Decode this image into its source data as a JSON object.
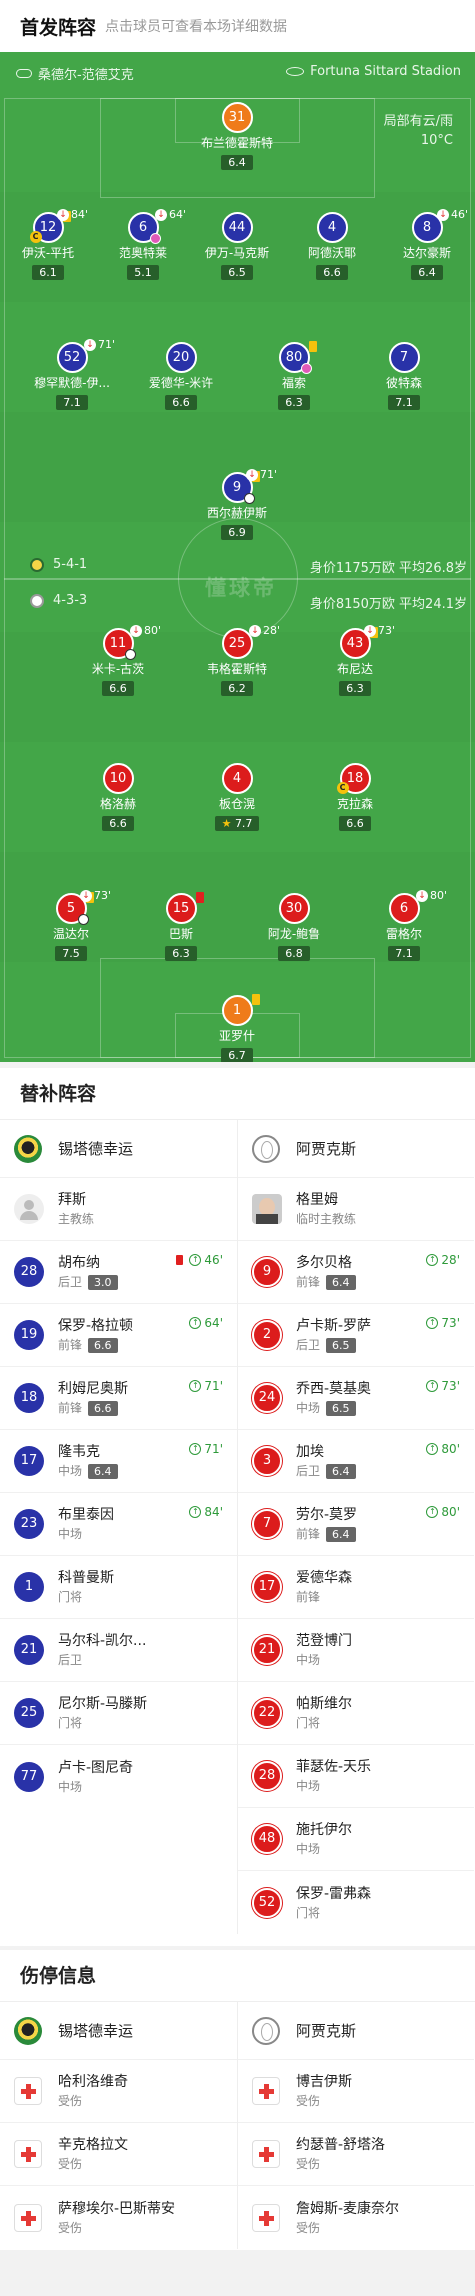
{
  "header": {
    "title": "首发阵容",
    "subtitle": "点击球员可查看本场详细数据"
  },
  "pitch": {
    "home_team": "桑德尔-范德艾克",
    "stadium": "Fortuna Sittard Stadion",
    "weather": "局部有云/雨",
    "temperature": "10°C",
    "watermark": "懂球帝",
    "home_formation": "5-4-1",
    "home_value": "身价1175万欧",
    "home_avg_age": "平均26.8岁",
    "away_formation": "4-3-3",
    "away_value": "身价8150万欧",
    "away_avg_age": "平均24.1岁"
  },
  "home_players": [
    {
      "num": "31",
      "name": "布兰德霍斯特",
      "rating": "6.4"
    },
    {
      "num": "12",
      "name": "伊沃-平托",
      "rating": "6.1",
      "sub": "84'",
      "captain": "C"
    },
    {
      "num": "6",
      "name": "范奥特莱",
      "rating": "5.1",
      "sub": "64'"
    },
    {
      "num": "44",
      "name": "伊万-马克斯",
      "rating": "6.5"
    },
    {
      "num": "4",
      "name": "阿德沃耶",
      "rating": "6.6"
    },
    {
      "num": "8",
      "name": "达尔豪斯",
      "rating": "6.4",
      "sub": "46'"
    },
    {
      "num": "52",
      "name": "穆罕默德-伊...",
      "rating": "7.1",
      "sub": "71'"
    },
    {
      "num": "20",
      "name": "爱德华-米许",
      "rating": "6.6"
    },
    {
      "num": "80",
      "name": "福索",
      "rating": "6.3"
    },
    {
      "num": "7",
      "name": "彼特森",
      "rating": "7.1"
    },
    {
      "num": "9",
      "name": "西尔赫伊斯",
      "rating": "6.9",
      "sub": "71'"
    }
  ],
  "away_players": [
    {
      "num": "11",
      "name": "米卡-古茨",
      "rating": "6.6",
      "sub": "80'"
    },
    {
      "num": "25",
      "name": "韦格霍斯特",
      "rating": "6.2",
      "sub": "28'"
    },
    {
      "num": "43",
      "name": "布尼达",
      "rating": "6.3",
      "sub": "73'"
    },
    {
      "num": "10",
      "name": "格洛赫",
      "rating": "6.6"
    },
    {
      "num": "4",
      "name": "板仓滉",
      "rating": "7.7",
      "star": "★"
    },
    {
      "num": "18",
      "name": "克拉森",
      "rating": "6.6",
      "captain": "C"
    },
    {
      "num": "5",
      "name": "温达尔",
      "rating": "7.5",
      "sub": "73'"
    },
    {
      "num": "15",
      "name": "巴斯",
      "rating": "6.3"
    },
    {
      "num": "30",
      "name": "阿龙-鲍鲁",
      "rating": "6.8"
    },
    {
      "num": "6",
      "name": "雷格尔",
      "rating": "7.1",
      "sub": "80'"
    },
    {
      "num": "1",
      "name": "亚罗什",
      "rating": "6.7"
    }
  ],
  "subs": {
    "title": "替补阵容",
    "home_team": "锡塔德幸运",
    "away_team": "阿贾克斯",
    "home_coach": {
      "name": "拜斯",
      "role": "主教练"
    },
    "away_coach": {
      "name": "格里姆",
      "role": "临时主教练"
    },
    "home": [
      {
        "num": "28",
        "name": "胡布纳",
        "pos": "后卫",
        "rating": "3.0",
        "minute": "46'"
      },
      {
        "num": "19",
        "name": "保罗-格拉顿",
        "pos": "前锋",
        "rating": "6.6",
        "minute": "64'"
      },
      {
        "num": "18",
        "name": "利姆尼奥斯",
        "pos": "前锋",
        "rating": "6.6",
        "minute": "71'"
      },
      {
        "num": "17",
        "name": "隆韦克",
        "pos": "中场",
        "rating": "6.4",
        "minute": "71'"
      },
      {
        "num": "23",
        "name": "布里泰因",
        "pos": "中场",
        "minute": "84'"
      },
      {
        "num": "1",
        "name": "科普曼斯",
        "pos": "门将"
      },
      {
        "num": "21",
        "name": "马尔科-凯尔...",
        "pos": "后卫"
      },
      {
        "num": "25",
        "name": "尼尔斯-马滕斯",
        "pos": "门将"
      },
      {
        "num": "77",
        "name": "卢卡-图尼奇",
        "pos": "中场"
      }
    ],
    "away": [
      {
        "num": "9",
        "name": "多尔贝格",
        "pos": "前锋",
        "rating": "6.4",
        "minute": "28'"
      },
      {
        "num": "2",
        "name": "卢卡斯-罗萨",
        "pos": "后卫",
        "rating": "6.5",
        "minute": "73'"
      },
      {
        "num": "24",
        "name": "乔西-莫基奥",
        "pos": "中场",
        "rating": "6.5",
        "minute": "73'"
      },
      {
        "num": "3",
        "name": "加埃",
        "pos": "后卫",
        "rating": "6.4",
        "minute": "80'"
      },
      {
        "num": "7",
        "name": "劳尔-莫罗",
        "pos": "前锋",
        "rating": "6.4",
        "minute": "80'"
      },
      {
        "num": "17",
        "name": "爱德华森",
        "pos": "前锋"
      },
      {
        "num": "21",
        "name": "范登博门",
        "pos": "中场"
      },
      {
        "num": "22",
        "name": "帕斯维尔",
        "pos": "门将"
      },
      {
        "num": "28",
        "name": "菲瑟佐-天乐",
        "pos": "中场"
      },
      {
        "num": "48",
        "name": "施托伊尔",
        "pos": "中场"
      },
      {
        "num": "52",
        "name": "保罗-雷弗森",
        "pos": "门将"
      }
    ]
  },
  "injuries": {
    "title": "伤停信息",
    "home_team": "锡塔德幸运",
    "away_team": "阿贾克斯",
    "home": [
      {
        "name": "哈利洛维奇",
        "status": "受伤"
      },
      {
        "name": "辛克格拉文",
        "status": "受伤"
      },
      {
        "name": "萨穆埃尔-巴斯蒂安",
        "status": "受伤"
      }
    ],
    "away": [
      {
        "name": "博吉伊斯",
        "status": "受伤"
      },
      {
        "name": "约瑟普-舒塔洛",
        "status": "受伤"
      },
      {
        "name": "詹姆斯-麦康奈尔",
        "status": "受伤"
      }
    ]
  },
  "colors": {
    "pitch": "#43a648",
    "home": "#2932a8",
    "away": "#dc1c1c",
    "keeper": "#ef7b1a"
  }
}
